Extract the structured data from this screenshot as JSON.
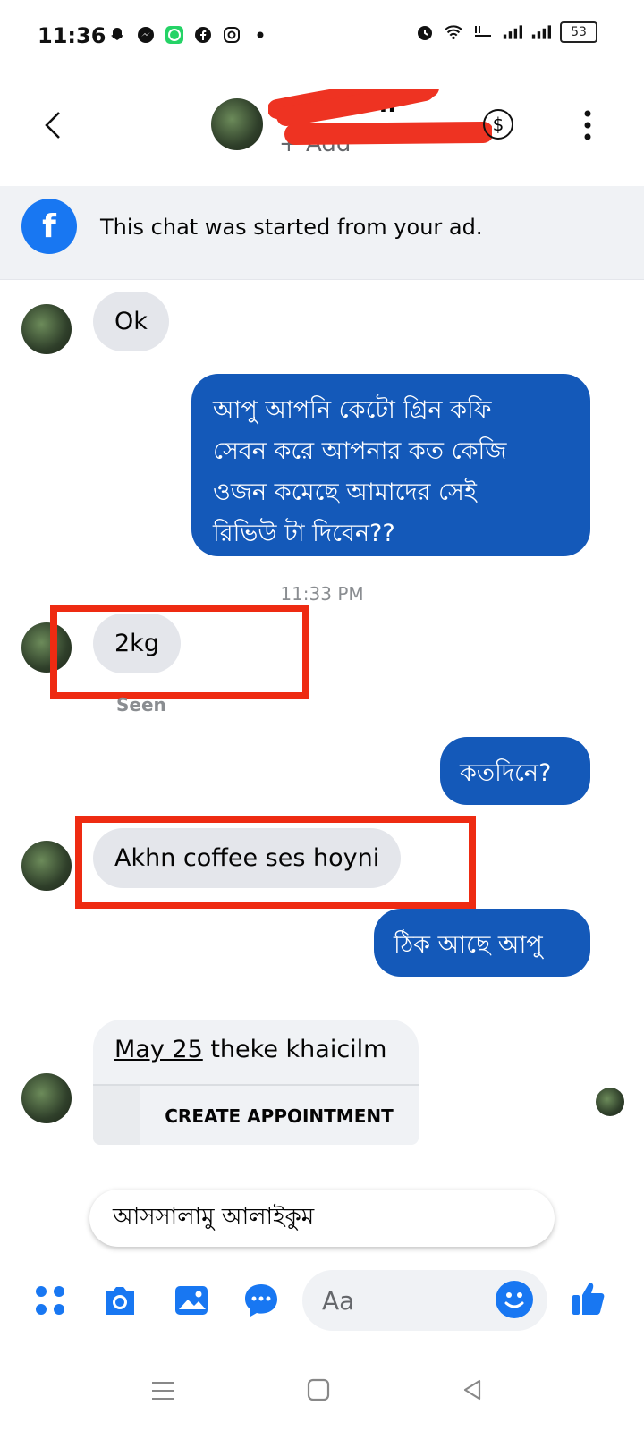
{
  "status_bar": {
    "time": "11:36",
    "battery": "53",
    "left_icons": [
      "snapchat-icon",
      "messenger-icon",
      "whatsapp-icon",
      "facebook-icon",
      "instagram-icon",
      "dot-icon"
    ],
    "right_icons": [
      "alarm-icon",
      "wifi-icon",
      "volte-icon",
      "signal-icon",
      "signal-icon"
    ]
  },
  "header": {
    "add_label": "+ Add",
    "name_fragment": "n"
  },
  "ad_banner": {
    "text": "This chat was started from your ad."
  },
  "messages": {
    "m1": "Ok",
    "m2_lines": [
      "আপু আপনি কেটো গ্রিন কফি",
      "সেবন করে আপনার কত কেজি",
      "ওজন কমেছে আমাদের সেই",
      "রিভিউ টা দিবেন??"
    ],
    "time": "11:33 PM",
    "m3": "2kg",
    "seen": "Seen",
    "m4": "কতদিনে?",
    "m5": "Akhn coffee ses hoyni",
    "m6": "ঠিক আছে আপু",
    "card_date": "May 25",
    "card_rest": " theke khaicilm",
    "card_button": "CREATE APPOINTMENT"
  },
  "quick_reply": "আসসালামু আলাইকুম",
  "composer": {
    "placeholder": "Aa"
  },
  "colors": {
    "messenger_blue": "#1877f2",
    "outgoing_bubble": "#1459b9",
    "incoming_bubble": "#e4e6eb",
    "highlight_red": "#ee2b12"
  }
}
